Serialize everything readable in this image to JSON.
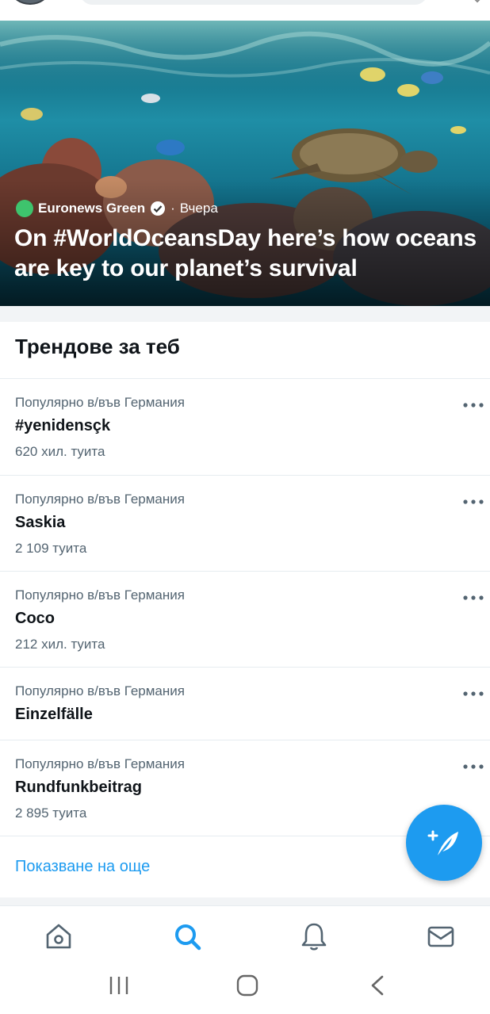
{
  "hero": {
    "source": "Euronews Green",
    "separator": "·",
    "time": "Вчера",
    "headline": "On #WorldOceansDay here’s how oceans are key to our planet’s survival"
  },
  "trends": {
    "title": "Трендове за теб",
    "items": [
      {
        "context": "Популярно в/във Германия",
        "name": "#yenidensçk",
        "count": "620 хил. туита"
      },
      {
        "context": "Популярно в/във Германия",
        "name": "Saskia",
        "count": "2 109 туита"
      },
      {
        "context": "Популярно в/във Германия",
        "name": "Coco",
        "count": "212 хил. туита"
      },
      {
        "context": "Популярно в/във Германия",
        "name": "Einzelfälle",
        "count": ""
      },
      {
        "context": "Популярно в/във Германия",
        "name": "Rundfunkbeitrag",
        "count": "2 895 туита"
      }
    ],
    "show_more": "Показване на още"
  },
  "nav": {
    "items": [
      "home-icon",
      "search-icon",
      "bell-icon",
      "mail-icon"
    ],
    "active": "search-icon"
  },
  "colors": {
    "accent": "#1d9bf0",
    "text_secondary": "#536471"
  }
}
